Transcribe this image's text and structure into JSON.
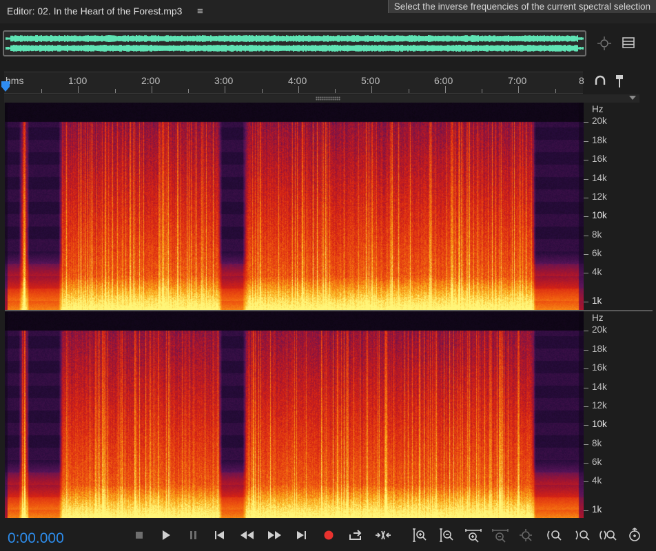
{
  "editor": {
    "title": "Editor: 02. In the Heart of the Forest.mp3",
    "tooltip": "Select the inverse frequencies of the current spectral selection"
  },
  "timeline": {
    "unit_label": "hms",
    "labels": [
      "1:00",
      "2:00",
      "3:00",
      "4:00",
      "5:00",
      "6:00",
      "7:00",
      "8"
    ]
  },
  "frequency_axis": {
    "unit": "Hz",
    "labels": [
      "20k",
      "18k",
      "16k",
      "14k",
      "12k",
      "10k",
      "8k",
      "6k",
      "4k",
      "1k"
    ]
  },
  "transport": {
    "time": "0:00.000"
  },
  "icons": {
    "panel_menu": "hamburger-icon",
    "overview_zoom": "zoom-target-icon",
    "panel_list": "list-icon",
    "snap": "magnet-icon",
    "marker": "marker-pin-icon"
  },
  "colors": {
    "waveform": "#5fe3b4",
    "playhead": "#2f8cf0",
    "record": "#e8322e",
    "timecode": "#2d8ceb"
  }
}
